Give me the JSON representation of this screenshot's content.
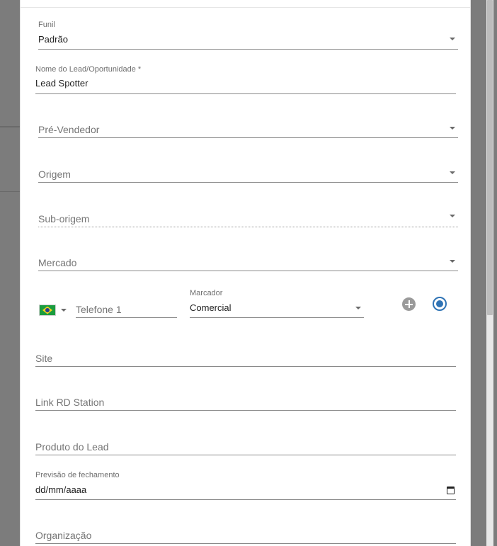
{
  "form": {
    "funil": {
      "label": "Funil",
      "value": "Padrão"
    },
    "nome": {
      "label": "Nome do Lead/Oportunidade *",
      "value": "Lead Spotter"
    },
    "pre_vendedor": {
      "placeholder": "Pré-Vendedor"
    },
    "origem": {
      "placeholder": "Origem"
    },
    "sub_origem": {
      "placeholder": "Sub-origem"
    },
    "mercado": {
      "placeholder": "Mercado"
    },
    "telefone": {
      "country_flag": "brazil-flag-icon",
      "placeholder": "Telefone 1",
      "marcador_label": "Marcador",
      "marcador_value": "Comercial",
      "add_icon": "plus-circle-icon",
      "primary_icon": "radio-checked-icon"
    },
    "site": {
      "placeholder": "Site"
    },
    "link_rd": {
      "placeholder": "Link RD Station"
    },
    "produto": {
      "placeholder": "Produto do Lead"
    },
    "previsao": {
      "label": "Previsão de fechamento",
      "value": "dd/mm/aaaa",
      "icon": "calendar-icon"
    },
    "organizacao": {
      "placeholder": "Organização"
    }
  },
  "colors": {
    "accent": "#2f73b5",
    "backdrop": "#7c7c7c",
    "text": "#222222",
    "placeholder": "#757575"
  }
}
